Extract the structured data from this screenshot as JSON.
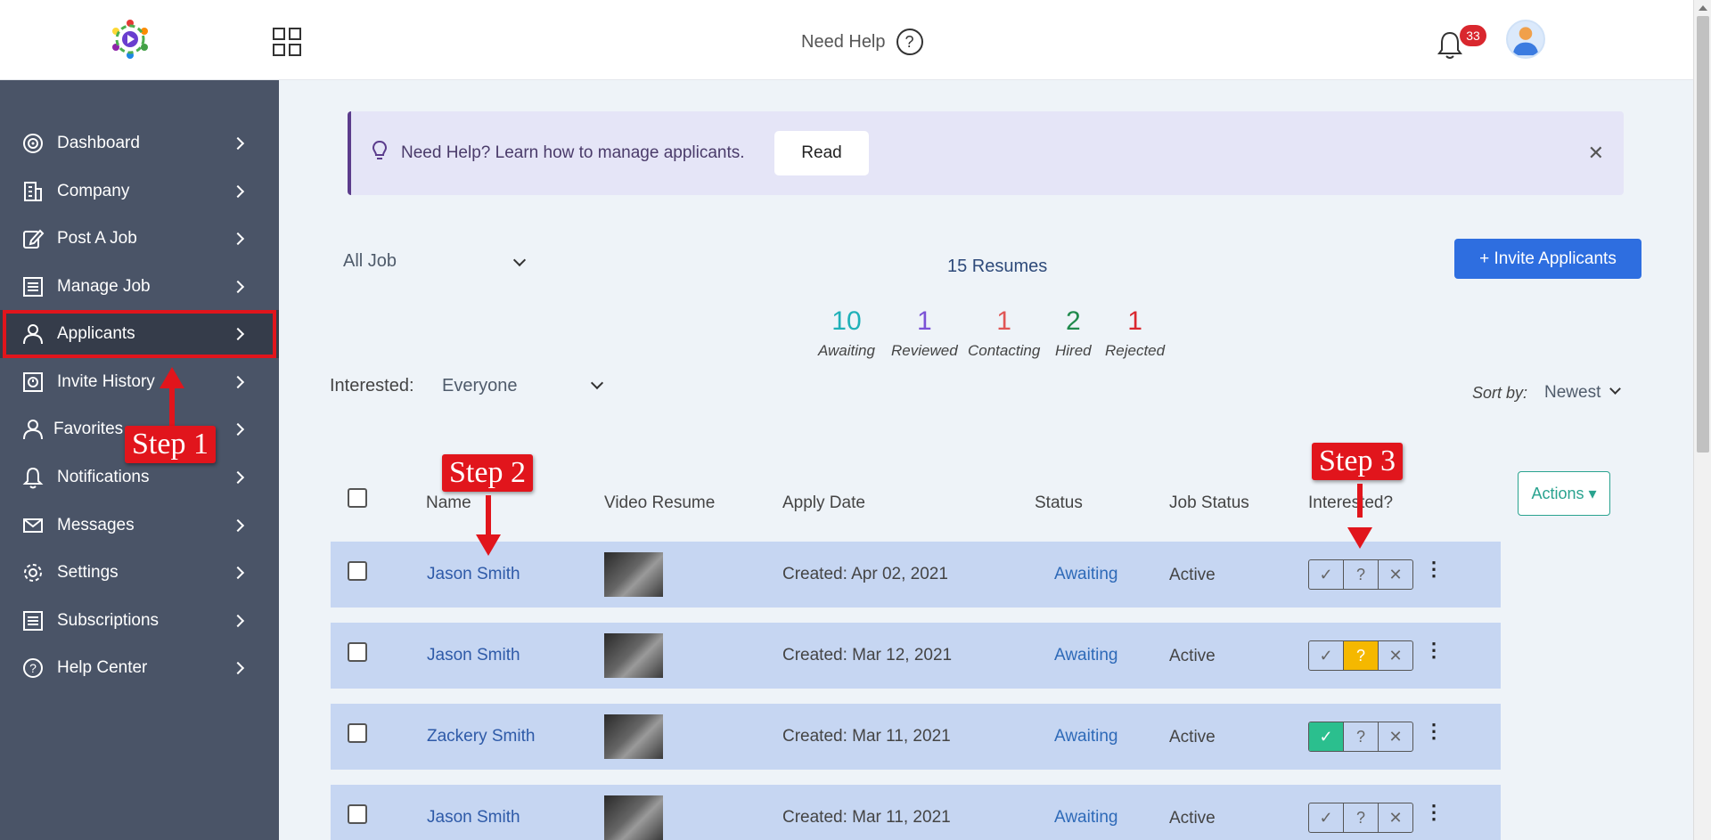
{
  "header": {
    "need_help": "Need Help",
    "help_glyph": "?",
    "notification_count": "33"
  },
  "sidebar": {
    "items": [
      {
        "label": "Dashboard",
        "icon": "dashboard-icon"
      },
      {
        "label": "Company",
        "icon": "building-icon"
      },
      {
        "label": "Post A Job",
        "icon": "edit-icon"
      },
      {
        "label": "Manage Job",
        "icon": "list-icon"
      },
      {
        "label": "Applicants",
        "icon": "user-icon"
      },
      {
        "label": "Invite History",
        "icon": "history-icon"
      },
      {
        "label": "Favorites",
        "icon": "user-icon"
      },
      {
        "label": "Notifications",
        "icon": "bell-icon"
      },
      {
        "label": "Messages",
        "icon": "mail-icon"
      },
      {
        "label": "Settings",
        "icon": "gear-icon"
      },
      {
        "label": "Subscriptions",
        "icon": "list-icon"
      },
      {
        "label": "Help Center",
        "icon": "help-icon"
      }
    ]
  },
  "banner": {
    "text": "Need Help? Learn how to manage applicants.",
    "read_label": "Read",
    "close_glyph": "✕"
  },
  "filters": {
    "job": "All Job",
    "interested_label": "Interested:",
    "interested_value": "Everyone",
    "sort_label": "Sort by:",
    "sort_value": "Newest"
  },
  "summary": {
    "resumes": "15 Resumes",
    "invite_label": "+ Invite Applicants",
    "stats": [
      {
        "num": "10",
        "label": "Awaiting",
        "color": "#1fb0b8"
      },
      {
        "num": "1",
        "label": "Reviewed",
        "color": "#7b52d6"
      },
      {
        "num": "1",
        "label": "Contacting",
        "color": "#e05555"
      },
      {
        "num": "2",
        "label": "Hired",
        "color": "#1f8a4c"
      },
      {
        "num": "1",
        "label": "Rejected",
        "color": "#d9272e"
      }
    ]
  },
  "table": {
    "headers": {
      "name": "Name",
      "video": "Video Resume",
      "date": "Apply Date",
      "status": "Status",
      "job_status": "Job Status",
      "interested": "Interested?"
    },
    "actions_label": "Actions",
    "seg_glyphs": {
      "yes": "✓",
      "maybe": "?",
      "no": "✕"
    },
    "kebab": "⋮",
    "rows": [
      {
        "name": "Jason Smith",
        "date": "Created: Apr 02, 2021",
        "status": "Awaiting",
        "job_status": "Active",
        "interested": "none"
      },
      {
        "name": "Jason Smith",
        "date": "Created: Mar 12, 2021",
        "status": "Awaiting",
        "job_status": "Active",
        "interested": "maybe"
      },
      {
        "name": "Zackery Smith",
        "date": "Created: Mar 11, 2021",
        "status": "Awaiting",
        "job_status": "Active",
        "interested": "yes"
      },
      {
        "name": "Jason Smith",
        "date": "Created: Mar 11, 2021",
        "status": "Awaiting",
        "job_status": "Active",
        "interested": "none"
      }
    ]
  },
  "annotations": {
    "step1": "Step 1",
    "step2": "Step 2",
    "step3": "Step 3",
    "color": "#e1151c"
  }
}
